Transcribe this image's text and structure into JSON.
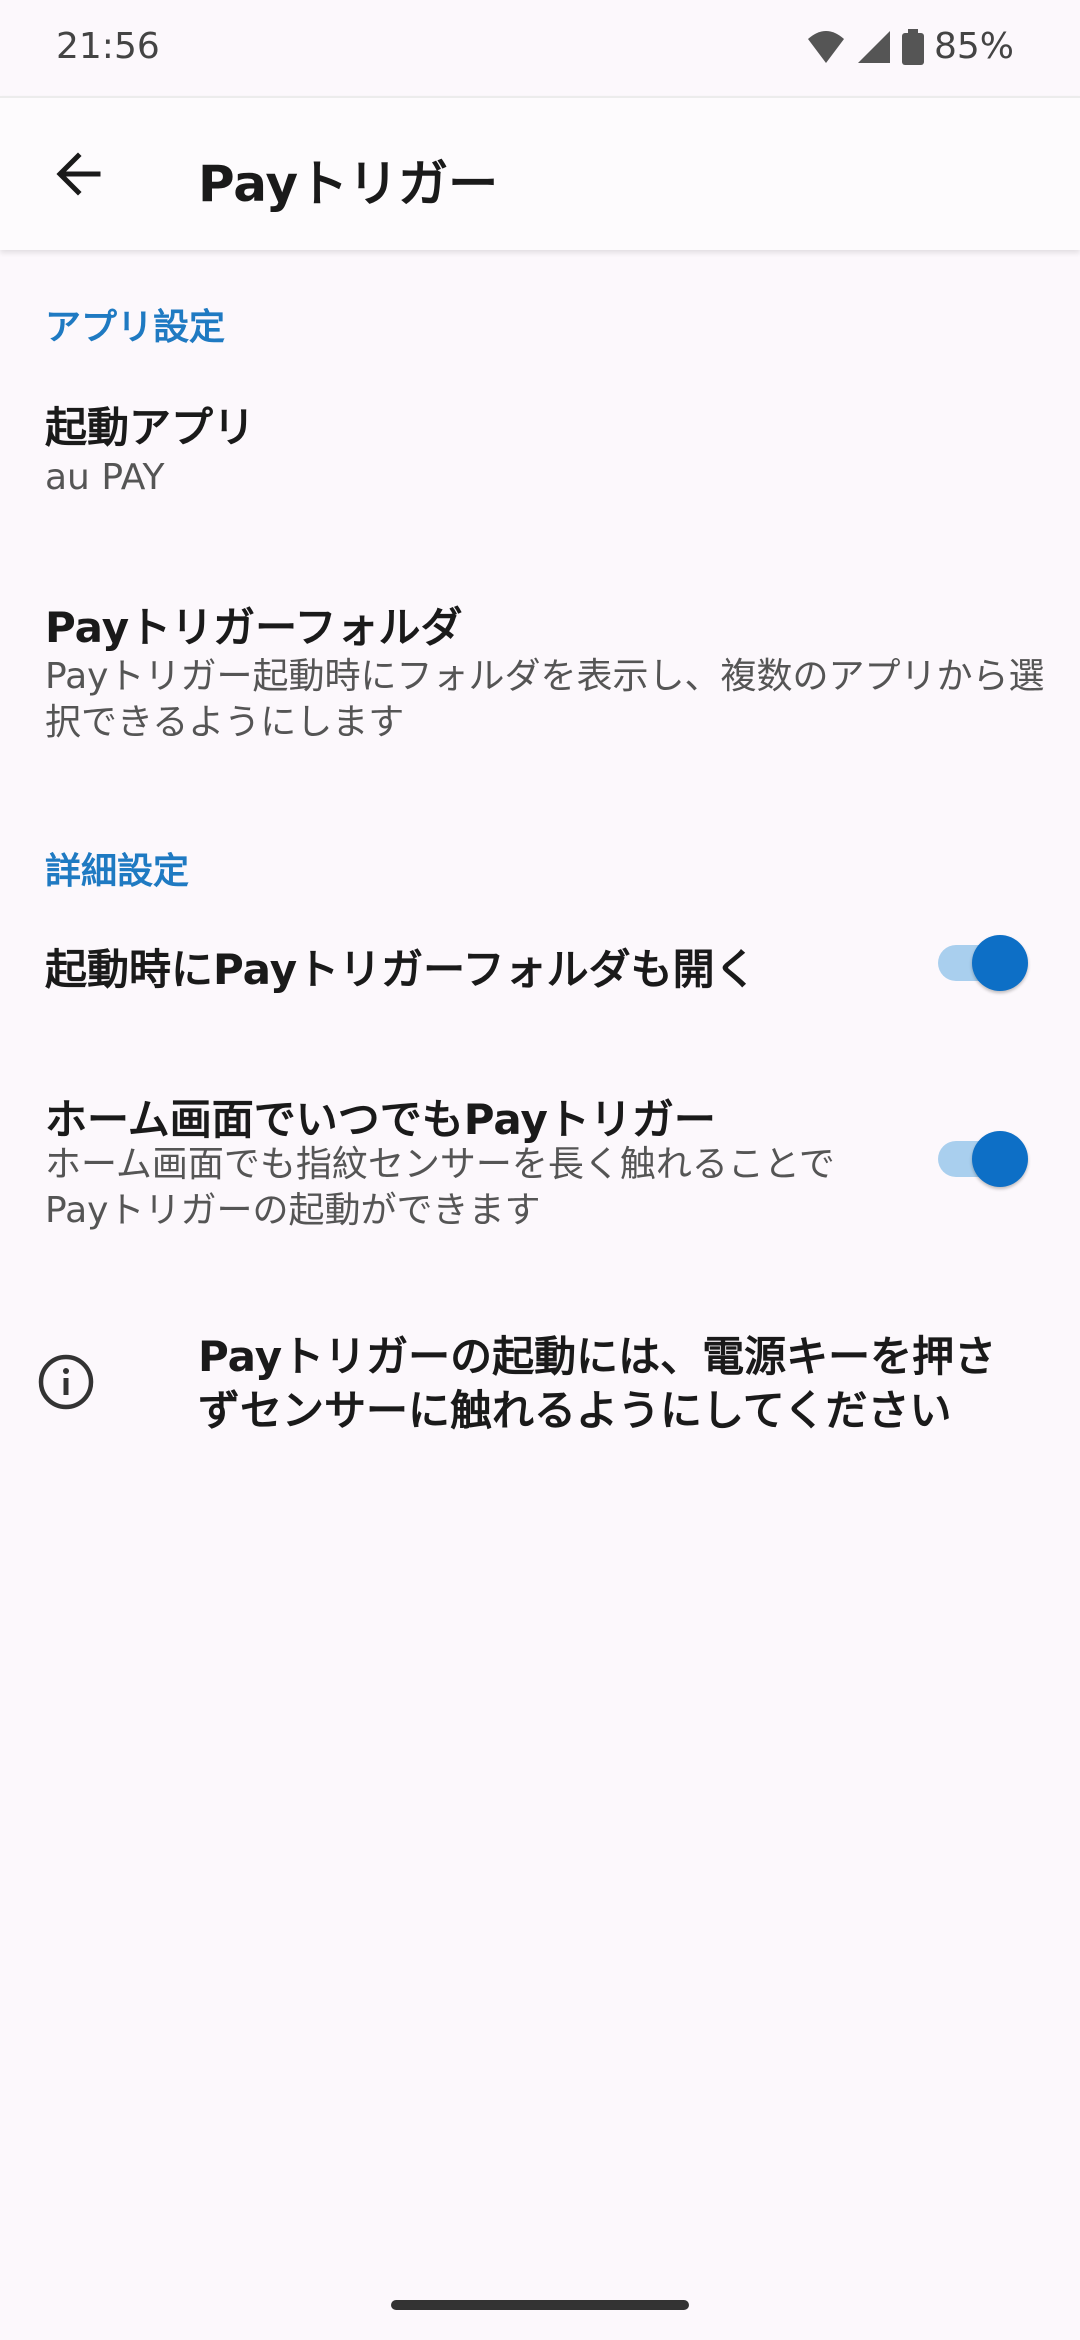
{
  "status_bar": {
    "time": "21:56",
    "battery": "85%",
    "icons": [
      "wifi-icon",
      "signal-icon",
      "battery-icon"
    ]
  },
  "app_bar": {
    "back_icon": "arrow-back-icon",
    "title": "Payトリガー"
  },
  "sections": {
    "app_settings": {
      "header": "アプリ設定",
      "launch_app": {
        "title": "起動アプリ",
        "summary": "au PAY"
      },
      "folder": {
        "title": "Payトリガーフォルダ",
        "summary": "Payトリガー起動時にフォルダを表示し、複数のアプリから選択できるようにします"
      }
    },
    "advanced_settings": {
      "header": "詳細設定",
      "open_folder_on_launch": {
        "title": "起動時にPayトリガーフォルダも開く",
        "enabled": true
      },
      "home_screen_trigger": {
        "title": "ホーム画面でいつでもPayトリガー",
        "summary": "ホーム画面でも指紋センサーを長く触れることでPayトリガーの起動ができます",
        "enabled": true
      }
    }
  },
  "info": {
    "icon": "info-icon",
    "text": "Payトリガーの起動には、電源キーを押さずセンサーに触れるようにしてください"
  },
  "colors": {
    "accent": "#1f7ac2",
    "toggle_thumb": "#0d6fc6",
    "toggle_track": "#a9cfee",
    "background": "#fcf8fc"
  }
}
